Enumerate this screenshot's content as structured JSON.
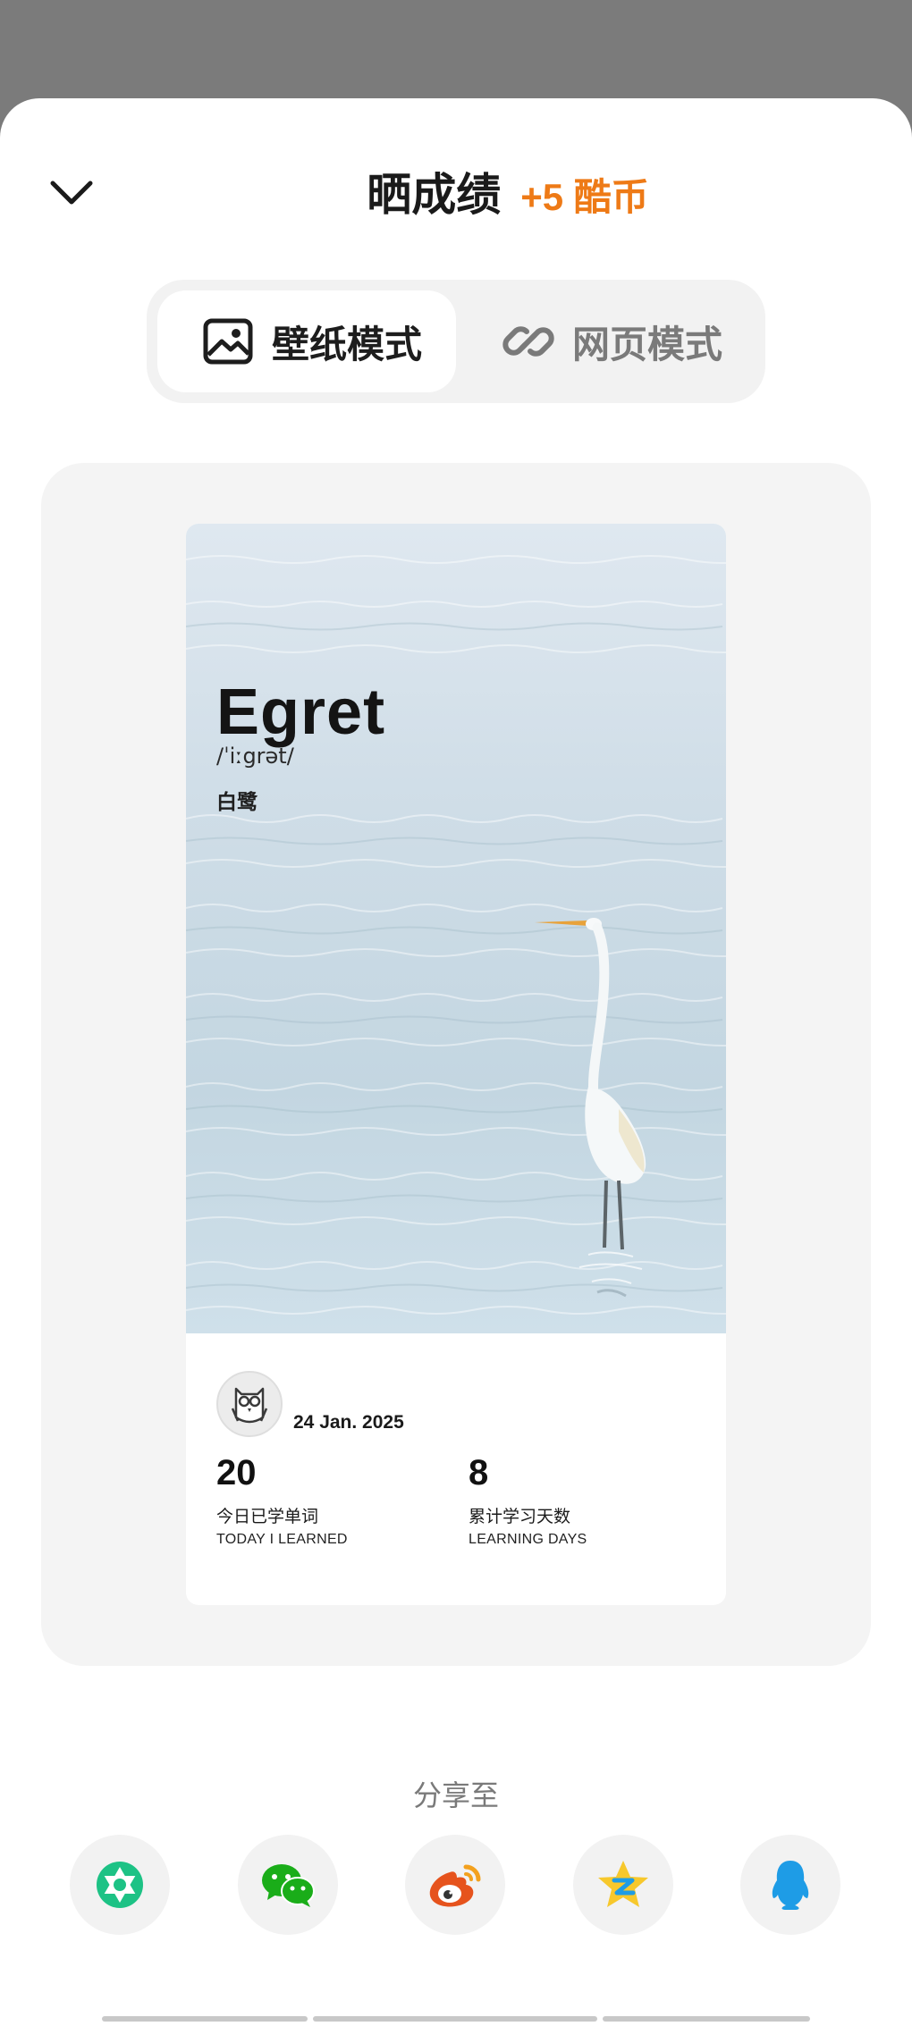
{
  "header": {
    "title": "晒成绩",
    "reward": "+5 酷币",
    "collapse_icon": "chevron-down-icon"
  },
  "mode_tabs": [
    {
      "label": "壁纸模式",
      "icon": "image-icon",
      "active": true
    },
    {
      "label": "网页模式",
      "icon": "link-icon",
      "active": false
    }
  ],
  "card": {
    "word": "Egret",
    "phonetic": "/ˈiːgrət/",
    "meaning": "白鹭",
    "date": "24 Jan. 2025",
    "stats": [
      {
        "value": "20",
        "label_cn": "今日已学单词",
        "label_en": "TODAY I LEARNED"
      },
      {
        "value": "8",
        "label_cn": "累计学习天数",
        "label_en": "LEARNING DAYS"
      }
    ]
  },
  "share": {
    "title": "分享至",
    "targets": [
      {
        "name": "moments",
        "icon": "wechat-moments-icon",
        "color": "#1dc285"
      },
      {
        "name": "wechat",
        "icon": "wechat-icon",
        "color": "#1aad19"
      },
      {
        "name": "weibo",
        "icon": "weibo-icon",
        "color": "#e6531d"
      },
      {
        "name": "qzone",
        "icon": "qzone-icon",
        "color": "#f7c82c"
      },
      {
        "name": "qq",
        "icon": "qq-icon",
        "color": "#1e9ce6"
      }
    ]
  },
  "colors": {
    "accent": "#ee7a16",
    "overlay": "#7b7b7b"
  }
}
